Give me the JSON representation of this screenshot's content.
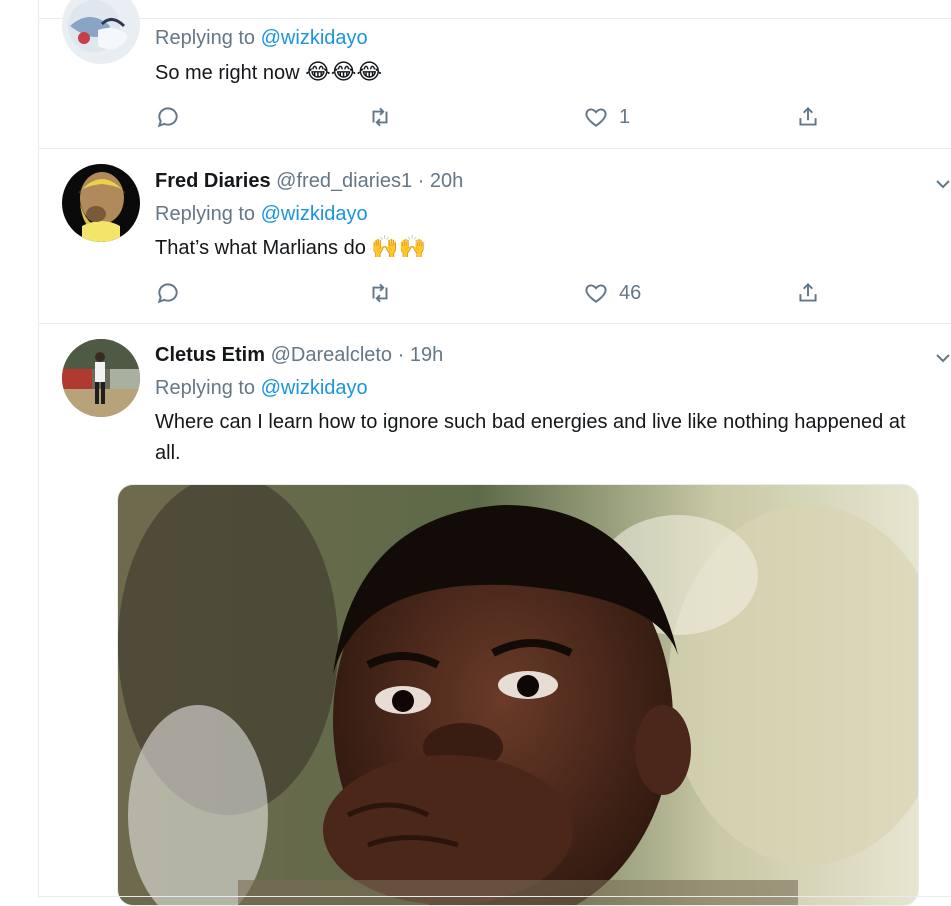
{
  "replying_prefix": "Replying to",
  "tweets": [
    {
      "name": "",
      "handle": "",
      "time": "",
      "reply_to": "@wizkidayo",
      "text": "So me right now",
      "emoji": "😂😂😂",
      "reply_count": "",
      "retweet_count": "",
      "like_count": "1"
    },
    {
      "name": "Fred Diaries",
      "handle": "@fred_diaries1",
      "separator": "·",
      "time": "20h",
      "reply_to": "@wizkidayo",
      "text": "That’s what Marlians do",
      "emoji": "🙌🙌",
      "like_count": "46"
    },
    {
      "name": "Cletus Etim",
      "handle": "@Darealcleto",
      "separator": "·",
      "time": "19h",
      "reply_to": "@wizkidayo",
      "text": "Where can I learn how to ignore such bad energies and live like nothing happened at all."
    }
  ],
  "colors": {
    "link": "#1b95e0",
    "secondary_text": "#657786",
    "divider": "#e6ecf0"
  },
  "icons": [
    "reply-icon",
    "retweet-icon",
    "like-icon",
    "share-icon",
    "chevron-down-icon"
  ]
}
